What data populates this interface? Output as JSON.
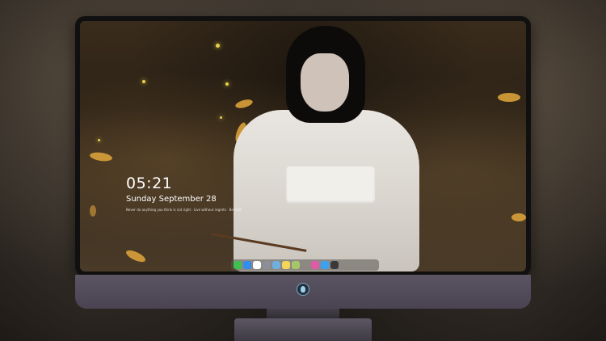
{
  "lock_screen": {
    "time": "05:21",
    "date": "Sunday September  28",
    "subtext": "Never do anything you think is not right · Live without regrets · Be kind"
  },
  "dock": {
    "apps": [
      {
        "name": "messages-icon",
        "color": "#3fbf4f"
      },
      {
        "name": "finder-icon",
        "color": "#2f8ef0"
      },
      {
        "name": "safari-icon",
        "color": "#ffffff"
      },
      {
        "name": "launchpad-icon",
        "color": "#8a8f9a"
      },
      {
        "name": "video-icon",
        "color": "#6fb0e0"
      },
      {
        "name": "notes-icon",
        "color": "#f5d45a"
      },
      {
        "name": "photos-icon",
        "color": "#a6c66a"
      },
      {
        "name": "itunes-icon",
        "color": "#e05aa8"
      },
      {
        "name": "app-store-icon",
        "color": "#3aa2f2"
      },
      {
        "name": "terminal-icon",
        "color": "#3a3a3a"
      }
    ]
  },
  "colors": {
    "leaf": "#d9a13a",
    "firefly": "#e6d24a",
    "chin": "#4f4957"
  }
}
